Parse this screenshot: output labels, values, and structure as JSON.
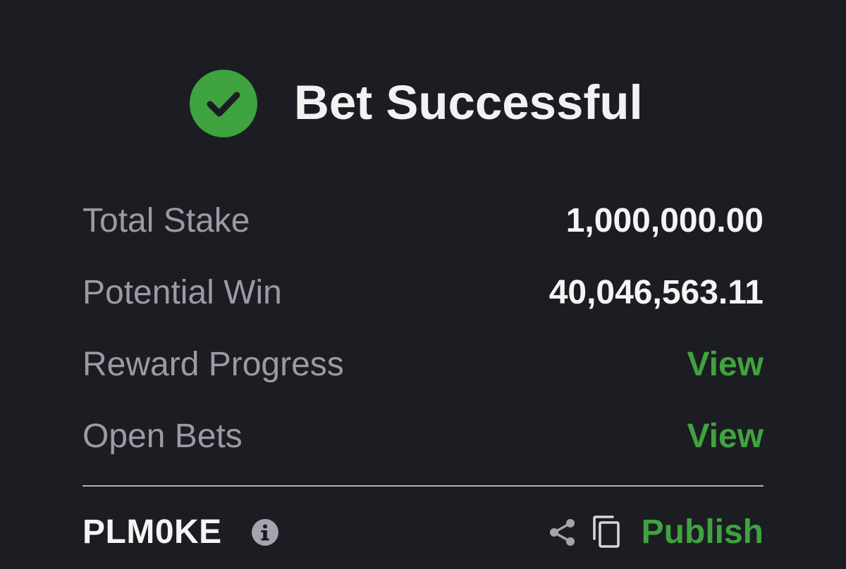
{
  "header": {
    "title": "Bet Successful",
    "icon": "check-circle-icon",
    "icon_color": "#3fa33f"
  },
  "summary": {
    "total_stake_label": "Total Stake",
    "total_stake_value": "1,000,000.00",
    "potential_win_label": "Potential Win",
    "potential_win_value": "40,046,563.11",
    "reward_progress_label": "Reward Progress",
    "reward_progress_link": "View",
    "open_bets_label": "Open Bets",
    "open_bets_link": "View"
  },
  "footer": {
    "booking_code": "PLM0KE",
    "info_icon": "info-icon",
    "share_icon": "share-icon",
    "copy_icon": "copy-icon",
    "publish_label": "Publish"
  },
  "colors": {
    "background": "#1c1d22",
    "accent": "#3fa33f",
    "label": "#9a9ba4",
    "value": "#f4f4f4"
  }
}
